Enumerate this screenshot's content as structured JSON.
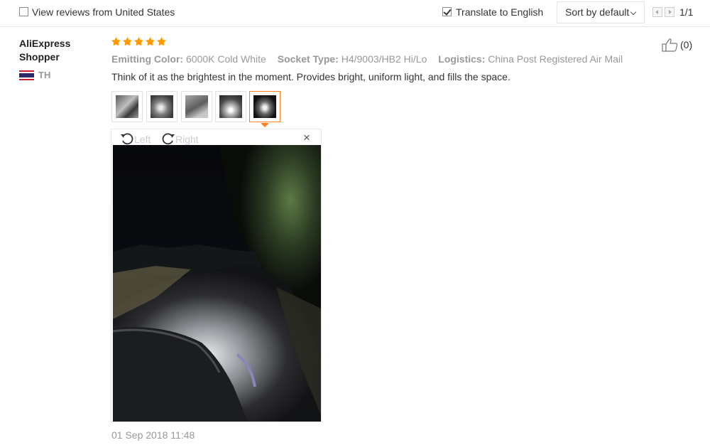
{
  "toolbar": {
    "view_us_label": "View reviews from United States",
    "view_us_checked": false,
    "translate_label": "Translate to English",
    "translate_checked": true,
    "sort_label": "Sort by default",
    "page_indicator": "1/1"
  },
  "review": {
    "reviewer_name": "AliExpress Shopper",
    "country_code": "TH",
    "rating": 5,
    "attributes": [
      {
        "key": "Emitting Color:",
        "value": "6000K Cold White"
      },
      {
        "key": "Socket Type:",
        "value": "H4/9003/HB2 Hi/Lo"
      },
      {
        "key": "Logistics:",
        "value": "China Post Registered Air Mail"
      }
    ],
    "text": "Think of it as the brightest in the moment. Provides bright, uniform light, and fills the space.",
    "likes": "(0)",
    "thumbnails_count": 5,
    "active_thumbnail": 5,
    "viewer": {
      "rotate_left_label": "Left",
      "rotate_right_label": "Right",
      "close_label": "×"
    },
    "date": "01 Sep 2018 11:48"
  },
  "colors": {
    "accent": "#ff7d1a",
    "star": "#ff9a00",
    "muted": "#999999"
  }
}
